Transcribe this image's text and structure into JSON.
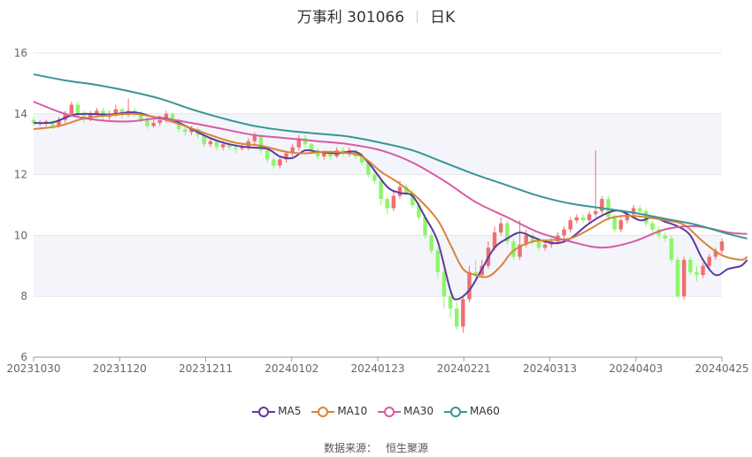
{
  "title": {
    "name": "万事利 301066",
    "period": "日K"
  },
  "source": {
    "label": "数据来源：",
    "value": "恒生聚源"
  },
  "colors": {
    "up": "#ef6f6f",
    "down": "#8ef56b",
    "grid": "#e6e6e6",
    "band": "#f3f5fa",
    "axis": "#999999"
  },
  "chart_data": {
    "type": "candlestick",
    "ylim": [
      6,
      16
    ],
    "yticks": [
      6,
      8,
      10,
      12,
      14,
      16
    ],
    "x_tick_labels": [
      "20231030",
      "20231120",
      "20231211",
      "20240102",
      "20240123",
      "20240221",
      "20240313",
      "20240403",
      "20240425"
    ],
    "grid": true,
    "legend_position": "bottom",
    "candles": [
      [
        13.8,
        13.7,
        13.9,
        13.6
      ],
      [
        13.7,
        13.7,
        13.8,
        13.6
      ],
      [
        13.7,
        13.75,
        13.8,
        13.6
      ],
      [
        13.75,
        13.6,
        13.8,
        13.5
      ],
      [
        13.6,
        13.8,
        13.9,
        13.55
      ],
      [
        13.8,
        14.0,
        14.1,
        13.7
      ],
      [
        14.0,
        14.3,
        14.4,
        13.9
      ],
      [
        14.3,
        14.0,
        14.4,
        13.9
      ],
      [
        14.0,
        13.8,
        14.1,
        13.7
      ],
      [
        13.8,
        14.0,
        14.1,
        13.75
      ],
      [
        14.0,
        14.1,
        14.2,
        13.9
      ],
      [
        14.1,
        13.9,
        14.2,
        13.8
      ],
      [
        13.9,
        14.0,
        14.1,
        13.8
      ],
      [
        14.0,
        14.15,
        14.3,
        13.9
      ],
      [
        14.15,
        14.0,
        14.2,
        13.85
      ],
      [
        14.0,
        14.1,
        14.5,
        13.9
      ],
      [
        14.1,
        14.0,
        14.2,
        13.9
      ],
      [
        14.0,
        13.8,
        14.1,
        13.7
      ],
      [
        13.8,
        13.6,
        13.9,
        13.5
      ],
      [
        13.6,
        13.7,
        13.8,
        13.55
      ],
      [
        13.7,
        13.8,
        13.95,
        13.6
      ],
      [
        13.8,
        14.0,
        14.1,
        13.7
      ],
      [
        14.0,
        13.8,
        14.05,
        13.7
      ],
      [
        13.8,
        13.5,
        13.85,
        13.4
      ],
      [
        13.5,
        13.4,
        13.6,
        13.3
      ],
      [
        13.4,
        13.5,
        13.6,
        13.3
      ],
      [
        13.5,
        13.3,
        13.55,
        13.2
      ],
      [
        13.3,
        13.0,
        13.35,
        12.9
      ],
      [
        13.0,
        13.1,
        13.2,
        12.9
      ],
      [
        13.1,
        12.9,
        13.15,
        12.8
      ],
      [
        12.9,
        13.0,
        13.1,
        12.8
      ],
      [
        13.0,
        12.9,
        13.05,
        12.8
      ],
      [
        12.9,
        12.85,
        13.0,
        12.7
      ],
      [
        12.85,
        12.9,
        13.0,
        12.8
      ],
      [
        12.9,
        13.1,
        13.2,
        12.8
      ],
      [
        13.1,
        13.3,
        13.4,
        13.0
      ],
      [
        13.3,
        12.8,
        13.3,
        12.7
      ],
      [
        12.8,
        12.5,
        12.85,
        12.4
      ],
      [
        12.5,
        12.3,
        12.6,
        12.2
      ],
      [
        12.3,
        12.5,
        12.6,
        12.2
      ],
      [
        12.5,
        12.7,
        12.8,
        12.4
      ],
      [
        12.7,
        12.9,
        13.0,
        12.6
      ],
      [
        12.9,
        13.2,
        13.3,
        12.8
      ],
      [
        13.2,
        13.0,
        13.3,
        12.9
      ],
      [
        13.0,
        12.8,
        13.05,
        12.7
      ],
      [
        12.8,
        12.6,
        12.85,
        12.5
      ],
      [
        12.6,
        12.7,
        12.8,
        12.5
      ],
      [
        12.7,
        12.6,
        12.8,
        12.5
      ],
      [
        12.6,
        12.8,
        12.9,
        12.55
      ],
      [
        12.8,
        12.7,
        12.9,
        12.6
      ],
      [
        12.7,
        12.8,
        12.9,
        12.6
      ],
      [
        12.8,
        12.6,
        12.85,
        12.5
      ],
      [
        12.6,
        12.4,
        12.7,
        12.3
      ],
      [
        12.4,
        12.0,
        12.45,
        11.9
      ],
      [
        12.0,
        11.8,
        12.1,
        11.7
      ],
      [
        11.8,
        11.2,
        11.9,
        11.0
      ],
      [
        11.2,
        10.9,
        11.3,
        10.7
      ],
      [
        10.9,
        11.3,
        11.5,
        10.8
      ],
      [
        11.3,
        11.6,
        11.8,
        11.2
      ],
      [
        11.6,
        11.4,
        11.7,
        11.3
      ],
      [
        11.4,
        11.0,
        11.5,
        10.9
      ],
      [
        11.0,
        10.6,
        11.1,
        10.5
      ],
      [
        10.6,
        10.0,
        10.7,
        9.9
      ],
      [
        10.0,
        9.5,
        10.1,
        9.4
      ],
      [
        9.5,
        8.8,
        9.6,
        8.6
      ],
      [
        8.8,
        8.0,
        8.9,
        7.6
      ],
      [
        8.0,
        7.6,
        8.2,
        7.3
      ],
      [
        7.6,
        7.0,
        7.8,
        6.9
      ],
      [
        7.0,
        7.9,
        8.0,
        6.8
      ],
      [
        7.9,
        8.8,
        9.0,
        7.8
      ],
      [
        8.8,
        8.7,
        9.2,
        8.6
      ],
      [
        8.7,
        9.0,
        9.2,
        8.6
      ],
      [
        9.0,
        9.6,
        9.8,
        8.9
      ],
      [
        9.6,
        10.1,
        10.3,
        9.5
      ],
      [
        10.1,
        10.4,
        10.6,
        10.0
      ],
      [
        10.4,
        9.8,
        10.5,
        9.7
      ],
      [
        9.8,
        9.3,
        9.9,
        9.2
      ],
      [
        9.3,
        9.7,
        10.5,
        9.2
      ],
      [
        9.7,
        10.0,
        10.2,
        9.6
      ],
      [
        10.0,
        9.8,
        10.1,
        9.7
      ],
      [
        9.8,
        9.6,
        9.9,
        9.5
      ],
      [
        9.6,
        9.7,
        9.8,
        9.5
      ],
      [
        9.7,
        9.8,
        9.9,
        9.6
      ],
      [
        9.8,
        10.0,
        10.1,
        9.7
      ],
      [
        10.0,
        10.2,
        10.3,
        9.9
      ],
      [
        10.2,
        10.5,
        10.6,
        10.1
      ],
      [
        10.5,
        10.6,
        10.7,
        10.4
      ],
      [
        10.6,
        10.5,
        10.7,
        10.4
      ],
      [
        10.5,
        10.7,
        10.8,
        10.4
      ],
      [
        10.7,
        10.8,
        12.8,
        10.6
      ],
      [
        10.8,
        11.2,
        11.3,
        10.7
      ],
      [
        11.2,
        10.6,
        11.3,
        10.5
      ],
      [
        10.6,
        10.2,
        10.7,
        10.1
      ],
      [
        10.2,
        10.5,
        10.6,
        10.1
      ],
      [
        10.5,
        10.7,
        10.8,
        10.4
      ],
      [
        10.7,
        10.9,
        11.0,
        10.6
      ],
      [
        10.9,
        10.8,
        11.0,
        10.7
      ],
      [
        10.8,
        10.4,
        10.9,
        10.3
      ],
      [
        10.4,
        10.2,
        10.5,
        10.1
      ],
      [
        10.2,
        10.0,
        10.3,
        9.9
      ],
      [
        10.0,
        9.9,
        10.1,
        9.8
      ],
      [
        9.9,
        9.2,
        10.0,
        9.1
      ],
      [
        9.2,
        8.0,
        9.3,
        7.95
      ],
      [
        8.0,
        9.2,
        9.3,
        7.9
      ],
      [
        9.2,
        8.8,
        9.3,
        8.7
      ],
      [
        8.8,
        8.7,
        9.0,
        8.5
      ],
      [
        8.7,
        9.0,
        9.1,
        8.6
      ],
      [
        9.0,
        9.3,
        9.4,
        8.9
      ],
      [
        9.3,
        9.5,
        9.6,
        9.2
      ],
      [
        9.5,
        9.8,
        9.9,
        9.4
      ]
    ],
    "series": [
      {
        "name": "MA5",
        "color": "#5b3a9e",
        "values": [
          [
            0,
            13.7
          ],
          [
            3,
            13.72
          ],
          [
            6,
            13.95
          ],
          [
            8,
            14.0
          ],
          [
            12,
            13.98
          ],
          [
            16,
            14.05
          ],
          [
            19,
            13.9
          ],
          [
            22,
            13.8
          ],
          [
            25,
            13.5
          ],
          [
            28,
            13.2
          ],
          [
            31,
            13.0
          ],
          [
            34,
            12.9
          ],
          [
            37,
            12.85
          ],
          [
            39,
            12.6
          ],
          [
            41,
            12.55
          ],
          [
            43,
            12.8
          ],
          [
            45,
            12.75
          ],
          [
            48,
            12.7
          ],
          [
            51,
            12.75
          ],
          [
            53,
            12.4
          ],
          [
            56,
            11.6
          ],
          [
            58,
            11.4
          ],
          [
            60,
            11.3
          ],
          [
            62,
            10.6
          ],
          [
            64,
            9.8
          ],
          [
            66,
            8.2
          ],
          [
            67,
            7.9
          ],
          [
            69,
            8.2
          ],
          [
            71,
            8.9
          ],
          [
            73,
            9.6
          ],
          [
            75,
            9.9
          ],
          [
            77,
            10.1
          ],
          [
            79,
            9.95
          ],
          [
            81,
            9.8
          ],
          [
            83,
            9.75
          ],
          [
            85,
            9.9
          ],
          [
            88,
            10.4
          ],
          [
            91,
            10.75
          ],
          [
            93,
            10.8
          ],
          [
            96,
            10.5
          ],
          [
            98,
            10.6
          ],
          [
            100,
            10.45
          ],
          [
            102,
            10.3
          ],
          [
            104,
            10.0
          ],
          [
            106,
            9.2
          ],
          [
            108,
            8.7
          ],
          [
            110,
            8.9
          ],
          [
            112,
            9.0
          ],
          [
            113,
            9.2
          ]
        ]
      },
      {
        "name": "MA10",
        "color": "#d9843a",
        "values": [
          [
            0,
            13.5
          ],
          [
            4,
            13.6
          ],
          [
            8,
            13.85
          ],
          [
            12,
            13.95
          ],
          [
            16,
            14.0
          ],
          [
            20,
            13.85
          ],
          [
            24,
            13.6
          ],
          [
            28,
            13.3
          ],
          [
            32,
            13.05
          ],
          [
            36,
            12.95
          ],
          [
            40,
            12.75
          ],
          [
            43,
            12.7
          ],
          [
            46,
            12.75
          ],
          [
            49,
            12.72
          ],
          [
            52,
            12.6
          ],
          [
            55,
            12.1
          ],
          [
            58,
            11.7
          ],
          [
            61,
            11.2
          ],
          [
            64,
            10.5
          ],
          [
            66,
            9.7
          ],
          [
            68,
            8.9
          ],
          [
            70,
            8.7
          ],
          [
            72,
            8.65
          ],
          [
            74,
            9.0
          ],
          [
            76,
            9.5
          ],
          [
            79,
            9.8
          ],
          [
            82,
            9.85
          ],
          [
            85,
            9.9
          ],
          [
            88,
            10.2
          ],
          [
            91,
            10.55
          ],
          [
            94,
            10.65
          ],
          [
            97,
            10.6
          ],
          [
            100,
            10.5
          ],
          [
            103,
            10.35
          ],
          [
            106,
            9.8
          ],
          [
            109,
            9.35
          ],
          [
            112,
            9.2
          ],
          [
            113,
            9.3
          ]
        ]
      },
      {
        "name": "MA30",
        "color": "#d95aa3",
        "values": [
          [
            0,
            14.4
          ],
          [
            5,
            14.0
          ],
          [
            10,
            13.8
          ],
          [
            15,
            13.75
          ],
          [
            20,
            13.85
          ],
          [
            25,
            13.7
          ],
          [
            30,
            13.5
          ],
          [
            35,
            13.3
          ],
          [
            40,
            13.2
          ],
          [
            45,
            13.1
          ],
          [
            50,
            13.0
          ],
          [
            55,
            12.8
          ],
          [
            60,
            12.4
          ],
          [
            65,
            11.8
          ],
          [
            70,
            11.1
          ],
          [
            75,
            10.6
          ],
          [
            80,
            10.1
          ],
          [
            85,
            9.8
          ],
          [
            90,
            9.6
          ],
          [
            95,
            9.8
          ],
          [
            100,
            10.2
          ],
          [
            105,
            10.3
          ],
          [
            110,
            10.1
          ],
          [
            113,
            10.05
          ]
        ]
      },
      {
        "name": "MA60",
        "color": "#3a9595",
        "values": [
          [
            0,
            15.3
          ],
          [
            5,
            15.1
          ],
          [
            10,
            14.95
          ],
          [
            15,
            14.75
          ],
          [
            20,
            14.5
          ],
          [
            25,
            14.15
          ],
          [
            30,
            13.85
          ],
          [
            35,
            13.6
          ],
          [
            40,
            13.45
          ],
          [
            45,
            13.35
          ],
          [
            50,
            13.25
          ],
          [
            55,
            13.05
          ],
          [
            60,
            12.8
          ],
          [
            65,
            12.4
          ],
          [
            70,
            12.0
          ],
          [
            75,
            11.65
          ],
          [
            80,
            11.3
          ],
          [
            85,
            11.05
          ],
          [
            90,
            10.9
          ],
          [
            95,
            10.75
          ],
          [
            100,
            10.55
          ],
          [
            105,
            10.35
          ],
          [
            110,
            10.05
          ],
          [
            113,
            9.9
          ]
        ]
      }
    ]
  }
}
